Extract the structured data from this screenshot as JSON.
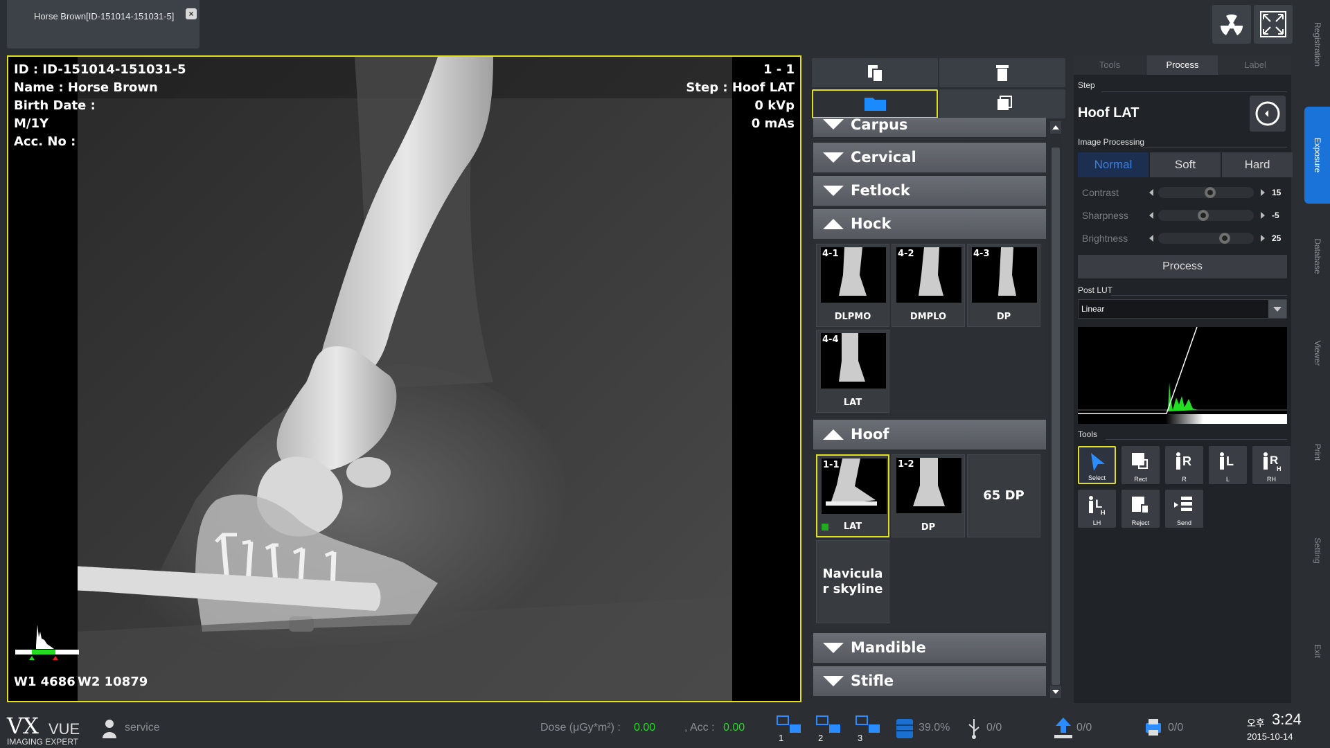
{
  "tab": {
    "title": "Horse Brown[ID-151014-151031-5]"
  },
  "patient": {
    "id_line": "ID : ID-151014-151031-5",
    "name_line": "Name : Horse Brown",
    "birth_line": "Birth Date :",
    "sex_age": "M/1Y",
    "acc_line": "Acc. No :"
  },
  "exposure_info": {
    "index": "1 - 1",
    "step": "Step : Hoof LAT",
    "kvp": "0 kVp",
    "mas": "0 mAs"
  },
  "window_level": {
    "w1": "W1 4686",
    "w2": "W2 10879"
  },
  "categories": {
    "carpus": "Carpus",
    "cervical": "Cervical",
    "fetlock": "Fetlock",
    "hock": "Hock",
    "hoof": "Hoof",
    "mandible": "Mandible",
    "stifle": "Stifle"
  },
  "hock_views": [
    {
      "num": "4-1",
      "label": "DLPMO"
    },
    {
      "num": "4-2",
      "label": "DMPLO"
    },
    {
      "num": "4-3",
      "label": "DP"
    },
    {
      "num": "4-4",
      "label": "LAT"
    }
  ],
  "hoof_views": [
    {
      "num": "1-1",
      "label": "LAT"
    },
    {
      "num": "1-2",
      "label": "DP"
    }
  ],
  "hoof_unacquired": [
    "65 DP",
    "Navicula r skyline"
  ],
  "right_panel": {
    "tabs": [
      "Tools",
      "Process",
      "Label"
    ],
    "step_label": "Step",
    "step_name": "Hoof LAT",
    "image_processing_label": "Image Processing",
    "modes": [
      "Normal",
      "Soft",
      "Hard"
    ],
    "sliders": [
      {
        "label": "Contrast",
        "value": "15",
        "level": 0.55
      },
      {
        "label": "Sharpness",
        "value": "-5",
        "level": 0.47
      },
      {
        "label": "Brightness",
        "value": "25",
        "level": 0.72
      }
    ],
    "process_button": "Process",
    "post_lut_label": "Post LUT",
    "post_lut_value": "Linear",
    "tools_label": "Tools",
    "tools": [
      {
        "label": "Select",
        "icon": "cursor-icon"
      },
      {
        "label": "Rect",
        "icon": "crop-icon"
      },
      {
        "label": "R",
        "icon": "marker-r-icon"
      },
      {
        "label": "L",
        "icon": "marker-l-icon"
      },
      {
        "label": "RH",
        "icon": "marker-rh-icon"
      },
      {
        "label": "LH",
        "icon": "marker-lh-icon"
      },
      {
        "label": "Reject",
        "icon": "reject-icon"
      },
      {
        "label": "Send",
        "icon": "send-icon"
      }
    ]
  },
  "side_tabs": [
    "Registration",
    "Exposure",
    "Database",
    "Viewer",
    "Print",
    "Setting",
    "Exit"
  ],
  "bottom": {
    "logo_main": "VX",
    "logo_sub": "VUE",
    "logo_tag": "IMAGING EXPERT",
    "user": "service",
    "dose_label": "Dose (μGy*m²) :",
    "dose_value": "0.00",
    "acc_label": ", Acc :",
    "acc_value": "0.00",
    "monitors": [
      "1",
      "2",
      "3"
    ],
    "storage": "39.0%",
    "usb": "0/0",
    "upload": "0/0",
    "print": "0/0",
    "ampm": "오후",
    "time": "3:24",
    "date": "2015-10-14"
  },
  "colors": {
    "highlight": "#e0e020",
    "accent_blue": "#1a73d9",
    "dose_green": "#22dd22"
  }
}
